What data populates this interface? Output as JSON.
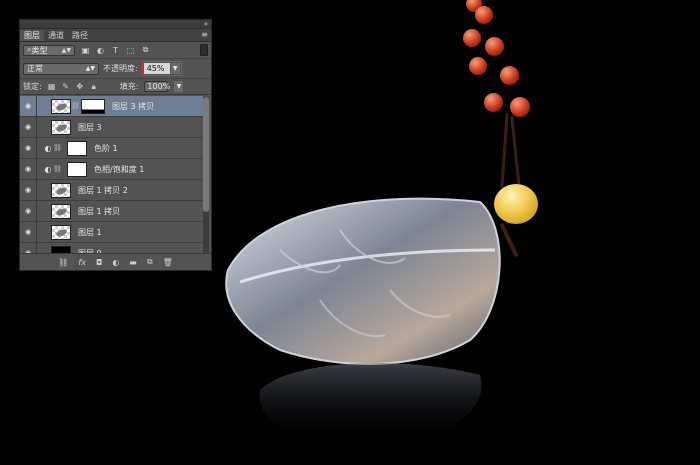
{
  "panel": {
    "tabs": [
      "图层",
      "通道",
      "路径"
    ],
    "filter": {
      "label": "类型"
    },
    "blend_mode": "正常",
    "opacity_label": "不透明度:",
    "opacity_value": "45%",
    "lock_label": "锁定:",
    "fill_label": "填充:",
    "fill_value": "100%",
    "layers": [
      {
        "name": "图层 3 拷贝",
        "selected": true,
        "thumb": "checker",
        "has_mask": true,
        "adjust_icon": ""
      },
      {
        "name": "图层 3",
        "selected": false,
        "thumb": "checker",
        "has_mask": false,
        "adjust_icon": ""
      },
      {
        "name": "色阶 1",
        "selected": false,
        "thumb": "white",
        "has_mask": false,
        "adjust_icon": "levels-icon"
      },
      {
        "name": "色相/饱和度 1",
        "selected": false,
        "thumb": "white",
        "has_mask": false,
        "adjust_icon": "hue-sat-icon"
      },
      {
        "name": "图层 1 拷贝 2",
        "selected": false,
        "thumb": "checker",
        "has_mask": false,
        "adjust_icon": ""
      },
      {
        "name": "图层 1 拷贝",
        "selected": false,
        "thumb": "checker",
        "has_mask": false,
        "adjust_icon": ""
      },
      {
        "name": "图层 1",
        "selected": false,
        "thumb": "checker",
        "has_mask": false,
        "adjust_icon": ""
      },
      {
        "name": "图层 0",
        "selected": false,
        "thumb": "black",
        "has_mask": false,
        "adjust_icon": ""
      }
    ],
    "bottom_icons": [
      "link-icon",
      "fx-icon",
      "mask-icon",
      "adjustment-icon",
      "folder-icon",
      "new-layer-icon",
      "trash-icon"
    ]
  },
  "colors": {
    "selected_layer": "#6f7f93",
    "opacity_highlight": "#d8383b",
    "panel_bg": "#535353"
  }
}
